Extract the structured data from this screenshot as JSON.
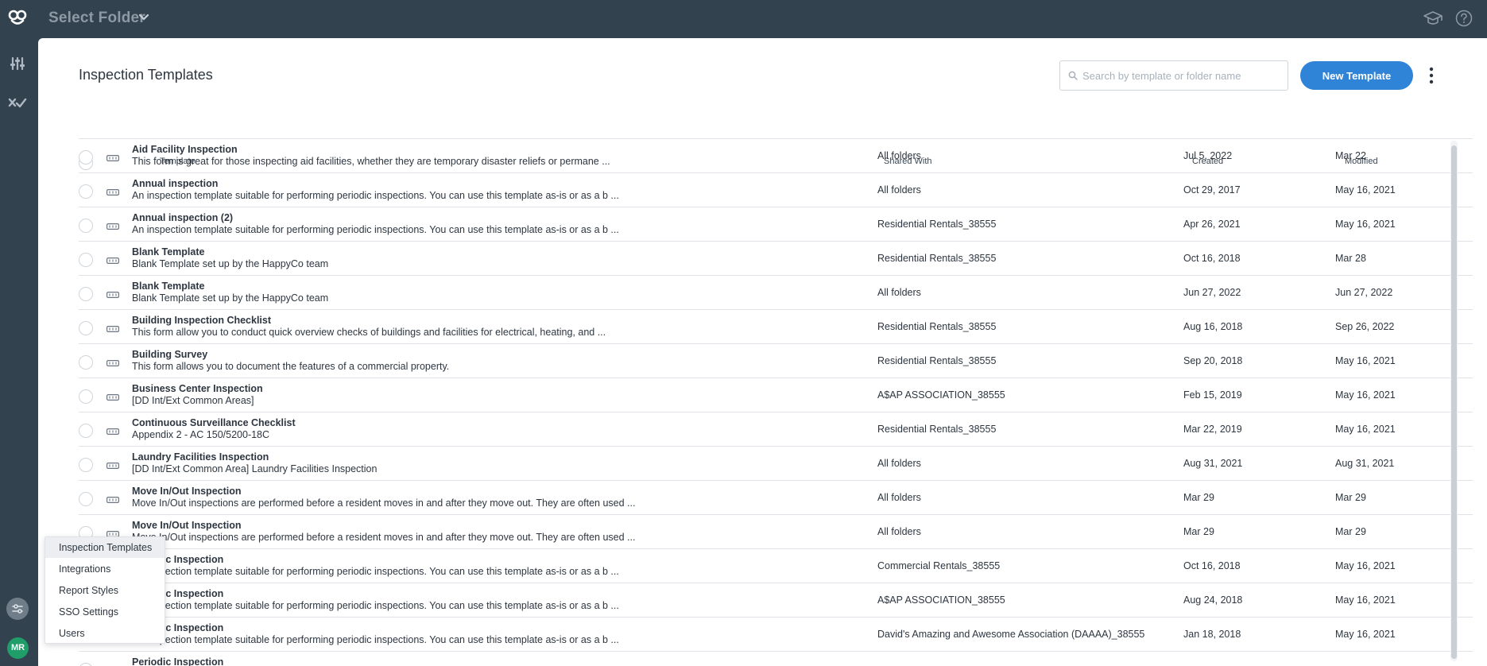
{
  "topbar": {
    "folder_title": "Select Folder",
    "logo_icon": "happyco-logo-icon",
    "right_icons": [
      "graduation-cap-icon",
      "help-circle-icon"
    ]
  },
  "rail": {
    "icons": [
      "sliders-icon",
      "checks-icon",
      "settings-icon"
    ],
    "avatar_initials": "MR"
  },
  "page": {
    "title": "Inspection Templates",
    "search_placeholder": "Search by template or folder name",
    "search_value": "",
    "new_button": "New Template"
  },
  "table": {
    "headers": {
      "template": "Template",
      "shared_with": "Shared With",
      "created": "Created",
      "modified": "Modified"
    },
    "rows": [
      {
        "name": "Aid Facility Inspection",
        "desc": "This form is great for those inspecting aid facilities, whether they are temporary disaster reliefs or permane ...",
        "shared": "All folders",
        "created": "Jul 5, 2022",
        "modified": "Mar 22"
      },
      {
        "name": "Annual inspection",
        "desc": "An inspection template suitable for performing periodic inspections. You can use this template as-is or as a b ...",
        "shared": "All folders",
        "created": "Oct 29, 2017",
        "modified": "May 16, 2021"
      },
      {
        "name": "Annual inspection (2)",
        "desc": "An inspection template suitable for performing periodic inspections. You can use this template as-is or as a b ...",
        "shared": "Residential Rentals_38555",
        "created": "Apr 26, 2021",
        "modified": "May 16, 2021"
      },
      {
        "name": "Blank Template",
        "desc": "Blank Template set up by the HappyCo team",
        "shared": "Residential Rentals_38555",
        "created": "Oct 16, 2018",
        "modified": "Mar 28"
      },
      {
        "name": "Blank Template",
        "desc": "Blank Template set up by the HappyCo team",
        "shared": "All folders",
        "created": "Jun 27, 2022",
        "modified": "Jun 27, 2022"
      },
      {
        "name": "Building Inspection Checklist",
        "desc": "This form allow you to conduct quick overview checks of buildings and facilities for electrical, heating, and ...",
        "shared": "Residential Rentals_38555",
        "created": "Aug 16, 2018",
        "modified": "Sep 26, 2022"
      },
      {
        "name": "Building Survey",
        "desc": "This form allows you to document the features of a commercial property.",
        "shared": "Residential Rentals_38555",
        "created": "Sep 20, 2018",
        "modified": "May 16, 2021"
      },
      {
        "name": "Business Center Inspection",
        "desc": "[DD Int/Ext Common Areas]",
        "shared": "A$AP ASSOCIATION_38555",
        "created": "Feb 15, 2019",
        "modified": "May 16, 2021"
      },
      {
        "name": "Continuous Surveillance Checklist",
        "desc": "Appendix 2 - AC 150/5200-18C",
        "shared": "Residential Rentals_38555",
        "created": "Mar 22, 2019",
        "modified": "May 16, 2021"
      },
      {
        "name": "Laundry Facilities Inspection",
        "desc": "[DD Int/Ext Common Area] Laundry Facilities Inspection",
        "shared": "All folders",
        "created": "Aug 31, 2021",
        "modified": "Aug 31, 2021"
      },
      {
        "name": "Move In/Out Inspection",
        "desc": "Move In/Out inspections are performed before a resident moves in and after they move out. They are often used ...",
        "shared": "All folders",
        "created": "Mar 29",
        "modified": "Mar 29"
      },
      {
        "name": "Move In/Out Inspection",
        "desc": "Move In/Out inspections are performed before a resident moves in and after they move out. They are often used ...",
        "shared": "All folders",
        "created": "Mar 29",
        "modified": "Mar 29"
      },
      {
        "name": "Periodic Inspection",
        "desc": "An inspection template suitable for performing periodic inspections. You can use this template as-is or as a b ...",
        "shared": "Commercial Rentals_38555",
        "created": "Oct 16, 2018",
        "modified": "May 16, 2021"
      },
      {
        "name": "Periodic Inspection",
        "desc": "An inspection template suitable for performing periodic inspections. You can use this template as-is or as a b ...",
        "shared": "A$AP ASSOCIATION_38555",
        "created": "Aug 24, 2018",
        "modified": "May 16, 2021"
      },
      {
        "name": "Periodic Inspection",
        "desc": "An inspection template suitable for performing periodic inspections. You can use this template as-is or as a b ...",
        "shared": "David's Amazing and Awesome Association (DAAAA)_38555",
        "created": "Jan 18, 2018",
        "modified": "May 16, 2021"
      },
      {
        "name": "Periodic Inspection",
        "desc": "",
        "shared": "",
        "created": "",
        "modified": ""
      }
    ]
  },
  "settings_menu": {
    "items": [
      "Inspection Templates",
      "Integrations",
      "Report Styles",
      "SSO Settings",
      "Users"
    ],
    "active": "Inspection Templates"
  }
}
